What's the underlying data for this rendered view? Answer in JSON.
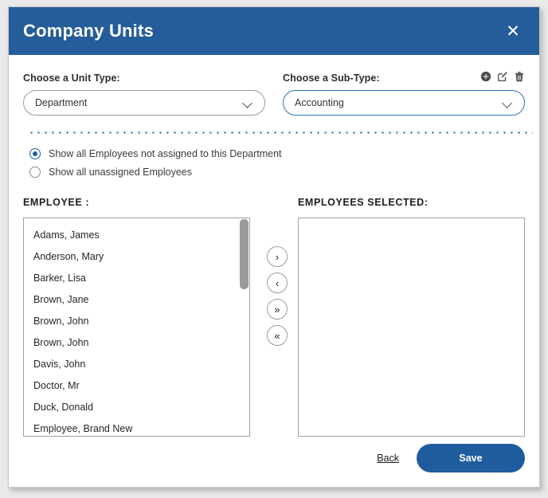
{
  "dialog": {
    "title": "Company Units",
    "close_label": "✕",
    "accent_color": "#245d99"
  },
  "unit_type": {
    "label": "Choose a Unit Type:",
    "value": "Department"
  },
  "sub_type": {
    "label": "Choose a Sub-Type:",
    "value": "Accounting",
    "actions": [
      {
        "name": "add-icon",
        "title": "Add"
      },
      {
        "name": "edit-icon",
        "title": "Edit"
      },
      {
        "name": "delete-icon",
        "title": "Delete"
      }
    ]
  },
  "filters": {
    "options": [
      {
        "label": "Show all Employees not assigned to this Department",
        "selected": true
      },
      {
        "label": "Show all unassigned Employees",
        "selected": false
      }
    ]
  },
  "available": {
    "heading": "EMPLOYEE :",
    "items": [
      "Adams, James",
      "Anderson, Mary",
      "Barker, Lisa",
      "Brown, Jane",
      "Brown, John",
      "Brown, John",
      "Davis, John",
      "Doctor, Mr",
      "Duck, Donald",
      "Employee, Brand New"
    ]
  },
  "selected": {
    "heading": "EMPLOYEES SELECTED:",
    "items": []
  },
  "transfer": {
    "buttons": [
      {
        "name": "move-right-button",
        "glyph": "›"
      },
      {
        "name": "move-left-button",
        "glyph": "‹"
      },
      {
        "name": "move-all-right-button",
        "glyph": "»"
      },
      {
        "name": "move-all-left-button",
        "glyph": "«"
      }
    ]
  },
  "footer": {
    "back_label": "Back",
    "save_label": "Save"
  }
}
